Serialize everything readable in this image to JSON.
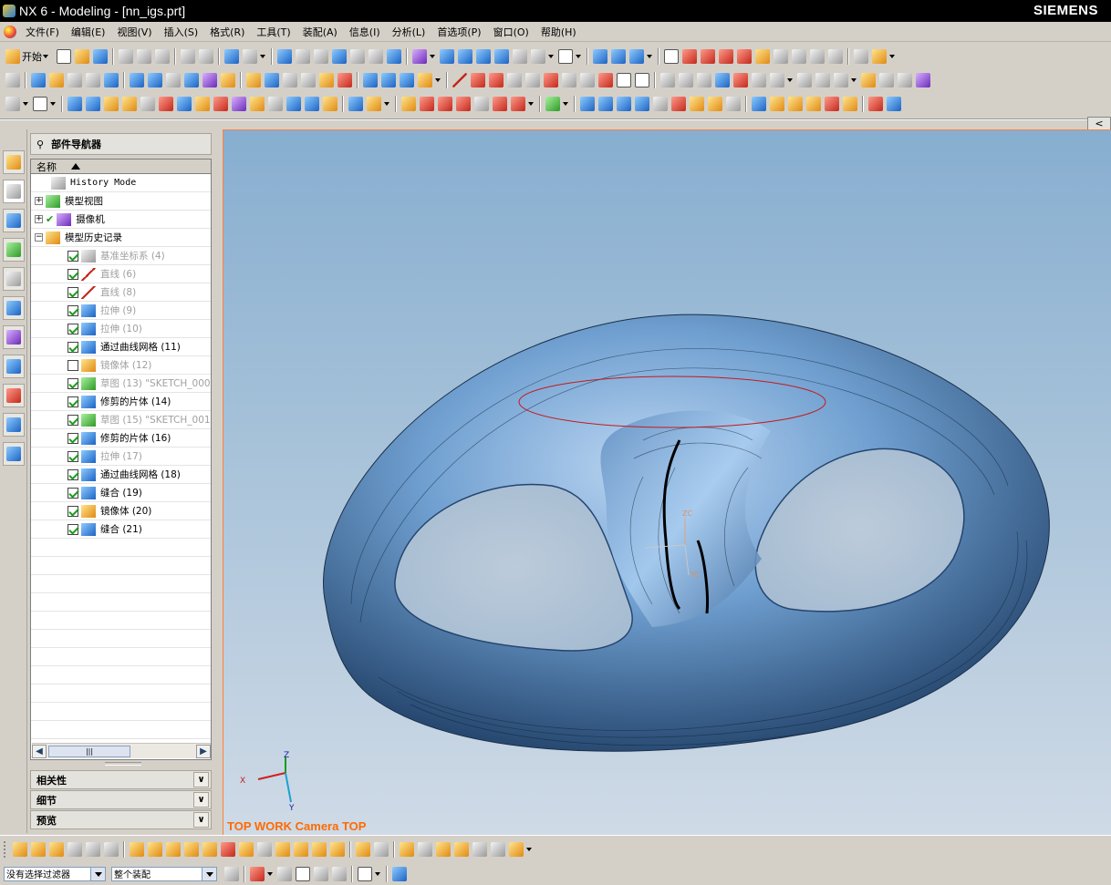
{
  "window": {
    "title": "NX 6 - Modeling - [nn_igs.prt]",
    "brand": "SIEMENS"
  },
  "menubar": [
    "文件(F)",
    "编辑(E)",
    "视图(V)",
    "插入(S)",
    "格式(R)",
    "工具(T)",
    "装配(A)",
    "信息(I)",
    "分析(L)",
    "首选项(P)",
    "窗口(O)",
    "帮助(H)"
  ],
  "toolbar": {
    "start_label": "开始"
  },
  "navigator": {
    "title": "部件导航器",
    "column_header": "名称",
    "items": [
      {
        "label": "History Mode",
        "icon": "clock-icon",
        "level": 1,
        "checked": null,
        "dim": false
      },
      {
        "label": "模型视图",
        "icon": "model-views-icon",
        "level": 0,
        "checked": null,
        "dim": false
      },
      {
        "label": "摄像机",
        "icon": "camera-icon",
        "level": 0,
        "checked": null,
        "dim": false
      },
      {
        "label": "模型历史记录",
        "icon": "folder-icon",
        "level": 0,
        "checked": null,
        "dim": false
      },
      {
        "label": "基准坐标系 (4)",
        "icon": "datum-csys-icon",
        "level": 2,
        "checked": true,
        "dim": true
      },
      {
        "label": "直线 (6)",
        "icon": "line-icon",
        "level": 2,
        "checked": true,
        "dim": true
      },
      {
        "label": "直线 (8)",
        "icon": "line-icon",
        "level": 2,
        "checked": true,
        "dim": true
      },
      {
        "label": "拉伸 (9)",
        "icon": "extrude-icon",
        "level": 2,
        "checked": true,
        "dim": true
      },
      {
        "label": "拉伸 (10)",
        "icon": "extrude-icon",
        "level": 2,
        "checked": true,
        "dim": true
      },
      {
        "label": "通过曲线网格 (11)",
        "icon": "through-curve-mesh-icon",
        "level": 2,
        "checked": true,
        "dim": false
      },
      {
        "label": "镜像体 (12)",
        "icon": "mirror-body-icon",
        "level": 2,
        "checked": false,
        "dim": true
      },
      {
        "label": "草图 (13) \"SKETCH_000",
        "icon": "sketch-icon",
        "level": 2,
        "checked": true,
        "dim": true
      },
      {
        "label": "修剪的片体 (14)",
        "icon": "trimmed-sheet-icon",
        "level": 2,
        "checked": true,
        "dim": false
      },
      {
        "label": "草图 (15) \"SKETCH_001",
        "icon": "sketch-icon",
        "level": 2,
        "checked": true,
        "dim": true
      },
      {
        "label": "修剪的片体 (16)",
        "icon": "trimmed-sheet-icon",
        "level": 2,
        "checked": true,
        "dim": false
      },
      {
        "label": "拉伸 (17)",
        "icon": "extrude-icon",
        "level": 2,
        "checked": true,
        "dim": true
      },
      {
        "label": "通过曲线网格 (18)",
        "icon": "through-curve-mesh-icon",
        "level": 2,
        "checked": true,
        "dim": false
      },
      {
        "label": "缝合 (19)",
        "icon": "sew-icon",
        "level": 2,
        "checked": true,
        "dim": false
      },
      {
        "label": "镜像体 (20)",
        "icon": "mirror-body-icon",
        "level": 2,
        "checked": true,
        "dim": false
      },
      {
        "label": "缝合 (21)",
        "icon": "sew-icon",
        "level": 2,
        "checked": true,
        "dim": false
      }
    ],
    "panels": [
      "相关性",
      "细节",
      "预览"
    ]
  },
  "viewport": {
    "label": "TOP WORK Camera TOP",
    "triad": {
      "x": "X",
      "y": "Y",
      "z": "Z"
    },
    "wcs_labels": {
      "zc": "ZC",
      "yc": "YC"
    }
  },
  "statusbar": {
    "filter_value": "没有选择过滤器",
    "scope_value": "整个装配"
  },
  "colors": {
    "accent": "#ff6a00",
    "model": "#5d8fc4",
    "titlebar": "#000000"
  }
}
